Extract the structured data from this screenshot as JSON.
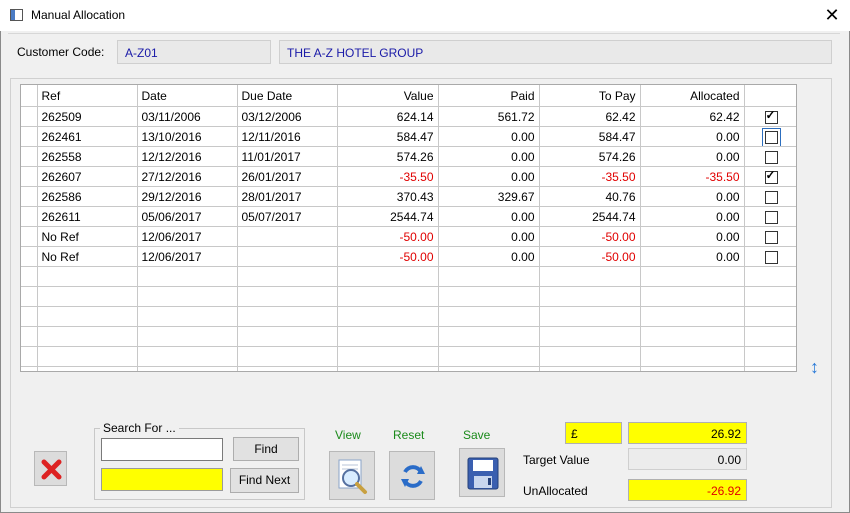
{
  "window": {
    "title": "Manual Allocation",
    "close_glyph": "✕"
  },
  "customer": {
    "label": "Customer Code:",
    "code": "A-Z01",
    "name": "THE A-Z HOTEL GROUP"
  },
  "grid": {
    "columns": [
      "Ref",
      "Date",
      "Due Date",
      "Value",
      "Paid",
      "To Pay",
      "Allocated"
    ],
    "rows": [
      {
        "ref": "262509",
        "date": "03/11/2006",
        "due": "03/12/2006",
        "value": "624.14",
        "paid": "561.72",
        "topay": "62.42",
        "allocated": "62.42",
        "checked": true,
        "neg": false,
        "alloc_neg": false
      },
      {
        "ref": "262461",
        "date": "13/10/2016",
        "due": "12/11/2016",
        "value": "584.47",
        "paid": "0.00",
        "topay": "584.47",
        "allocated": "0.00",
        "checked": false,
        "neg": false,
        "alloc_neg": false
      },
      {
        "ref": "262558",
        "date": "12/12/2016",
        "due": "11/01/2017",
        "value": "574.26",
        "paid": "0.00",
        "topay": "574.26",
        "allocated": "0.00",
        "checked": false,
        "neg": false,
        "alloc_neg": false
      },
      {
        "ref": "262607",
        "date": "27/12/2016",
        "due": "26/01/2017",
        "value": "-35.50",
        "paid": "0.00",
        "topay": "-35.50",
        "allocated": "-35.50",
        "checked": true,
        "neg": true,
        "alloc_neg": true
      },
      {
        "ref": "262586",
        "date": "29/12/2016",
        "due": "28/01/2017",
        "value": "370.43",
        "paid": "329.67",
        "topay": "40.76",
        "allocated": "0.00",
        "checked": false,
        "neg": false,
        "alloc_neg": false
      },
      {
        "ref": "262611",
        "date": "05/06/2017",
        "due": "05/07/2017",
        "value": "2544.74",
        "paid": "0.00",
        "topay": "2544.74",
        "allocated": "0.00",
        "checked": false,
        "neg": false,
        "alloc_neg": false
      },
      {
        "ref": "No Ref",
        "date": "12/06/2017",
        "due": "",
        "value": "-50.00",
        "paid": "0.00",
        "topay": "-50.00",
        "allocated": "0.00",
        "checked": false,
        "neg": true,
        "alloc_neg": false
      },
      {
        "ref": "No Ref",
        "date": "12/06/2017",
        "due": "",
        "value": "-50.00",
        "paid": "0.00",
        "topay": "-50.00",
        "allocated": "0.00",
        "checked": false,
        "neg": true,
        "alloc_neg": false
      }
    ],
    "empty_rows": 6
  },
  "search": {
    "group_label": "Search For ...",
    "value": "",
    "find_label": "Find",
    "find_next_label": "Find Next"
  },
  "actions": {
    "view_label": "View",
    "reset_label": "Reset",
    "save_label": "Save"
  },
  "totals": {
    "currency": "£",
    "top_value": "26.92",
    "target_label": "Target Value",
    "target_value": "0.00",
    "unallocated_label": "UnAllocated",
    "unallocated_value": "-26.92"
  },
  "colors": {
    "negative": "#e00000",
    "highlight": "#ffff00",
    "action_label": "#1a8a1a"
  }
}
